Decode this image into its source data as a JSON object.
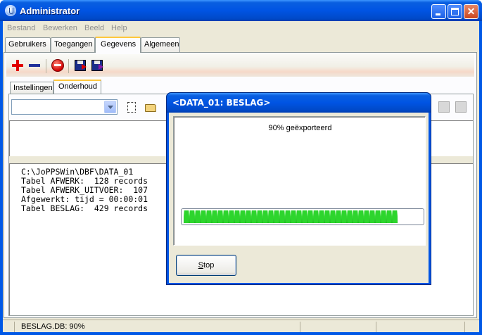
{
  "window": {
    "title": "Administrator"
  },
  "menu": [
    "Bestand",
    "Bewerken",
    "Beeld",
    "Help"
  ],
  "tabs": [
    {
      "label": "Gebruikers"
    },
    {
      "label": "Toegangen"
    },
    {
      "label": "Gegevens",
      "active": true
    },
    {
      "label": "Algemeen"
    }
  ],
  "subtabs": [
    {
      "label": "Instellingen"
    },
    {
      "label": "Onderhoud",
      "active": true
    }
  ],
  "toolbar": {
    "icons": [
      "add-icon",
      "remove-icon",
      "stop-icon",
      "save-export-icon",
      "save-import-icon"
    ]
  },
  "combo": {
    "value": ""
  },
  "log": {
    "lines": [
      "C:\\JoPPSWin\\DBF\\DATA_01",
      "Tabel AFWERK:  128 records",
      "Tabel AFWERK_UITVOER:  107",
      "Afgewerkt: tijd = 00:00:01",
      "Tabel BESLAG:  429 records"
    ]
  },
  "status": {
    "text": "BESLAG.DB: 90%"
  },
  "dialog": {
    "title": "<DATA_01: BESLAG>",
    "message": "90% geëxporteerd",
    "progress": 0.9,
    "stop_label": "Stop",
    "stop_mnemonic": "S",
    "stop_rest": "top"
  },
  "colors": {
    "titlebar": "#0054e3",
    "progress": "#2dd52d",
    "tab_highlight": "#ffc73c"
  }
}
